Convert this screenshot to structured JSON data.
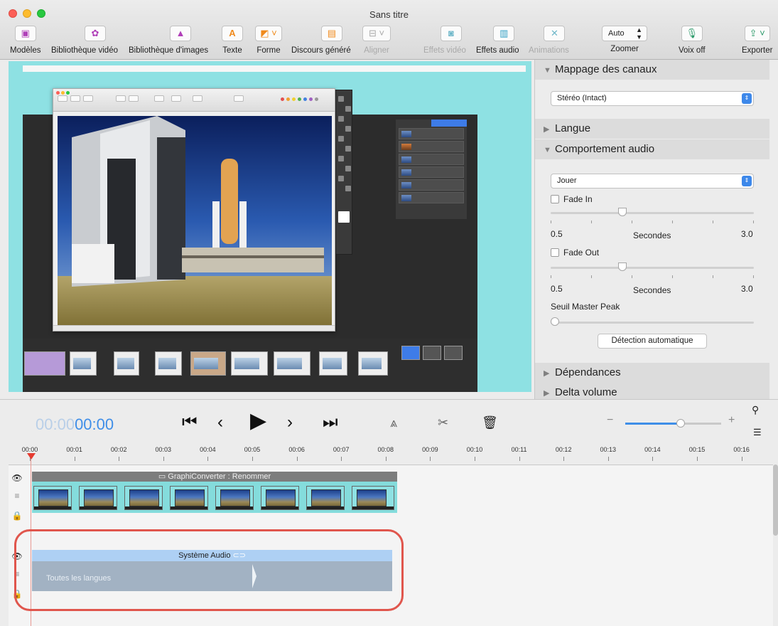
{
  "window": {
    "title": "Sans titre"
  },
  "toolbar": {
    "items": [
      {
        "label": "Modèles",
        "icon": "templates-icon"
      },
      {
        "label": "Bibliothèque vidéo",
        "icon": "film-reel-icon"
      },
      {
        "label": "Bibliothèque d'images",
        "icon": "image-library-icon"
      },
      {
        "label": "Texte",
        "icon": "text-icon"
      },
      {
        "label": "Forme",
        "icon": "shape-icon"
      },
      {
        "label": "Discours généré",
        "icon": "speech-icon"
      },
      {
        "label": "Aligner",
        "icon": "align-icon",
        "disabled": true
      },
      {
        "label": "Effets vidéo",
        "icon": "video-effects-icon",
        "disabled": true
      },
      {
        "label": "Effets audio",
        "icon": "audio-effects-icon"
      },
      {
        "label": "Animations",
        "icon": "animations-icon",
        "disabled": true
      },
      {
        "label": "Zoomer",
        "icon": "zoom-field-icon"
      },
      {
        "label": "Voix off",
        "icon": "microphone-icon"
      },
      {
        "label": "Exporter",
        "icon": "export-icon"
      }
    ],
    "zoom_value": "Auto"
  },
  "inspector": {
    "sections": {
      "channel_mapping": "Mappage des canaux",
      "language": "Langue",
      "audio_behavior": "Comportement audio",
      "dependencies": "Dépendances",
      "delta_volume": "Delta volume"
    },
    "channel_popup": "Stéréo (Intact)",
    "behavior_popup": "Jouer",
    "fade_in": {
      "label": "Fade In",
      "checked": false,
      "min": "0.5",
      "unit": "Secondes",
      "max": "3.0",
      "level": 0.2
    },
    "fade_out": {
      "label": "Fade Out",
      "checked": false,
      "min": "0.5",
      "unit": "Secondes",
      "max": "3.0",
      "level": 0.2
    },
    "master_peak": {
      "label": "Seuil Master Peak",
      "level": 0.0
    },
    "auto_detect_button": "Détection automatique"
  },
  "transport": {
    "timecode_dim": "00:00",
    "timecode": "00:00",
    "zoom_level": 0.58
  },
  "ruler": {
    "labels": [
      "00:00",
      "00:01",
      "00:02",
      "00:03",
      "00:04",
      "00:05",
      "00:06",
      "00:07",
      "00:08",
      "00:09",
      "00:10",
      "00:11",
      "00:12",
      "00:13",
      "00:14",
      "00:15",
      "00:16",
      "0"
    ]
  },
  "tracks": {
    "video_clip_title": "GraphiConverter : Renommer",
    "audio_clip_title": "Système Audio",
    "audio_clip_language": "Toutes les langues"
  },
  "colors": {
    "accent": "#3f8ee8",
    "canvas_bg": "#8ee1e3",
    "highlight": "#e0564d",
    "playhead": "#e53b30"
  }
}
